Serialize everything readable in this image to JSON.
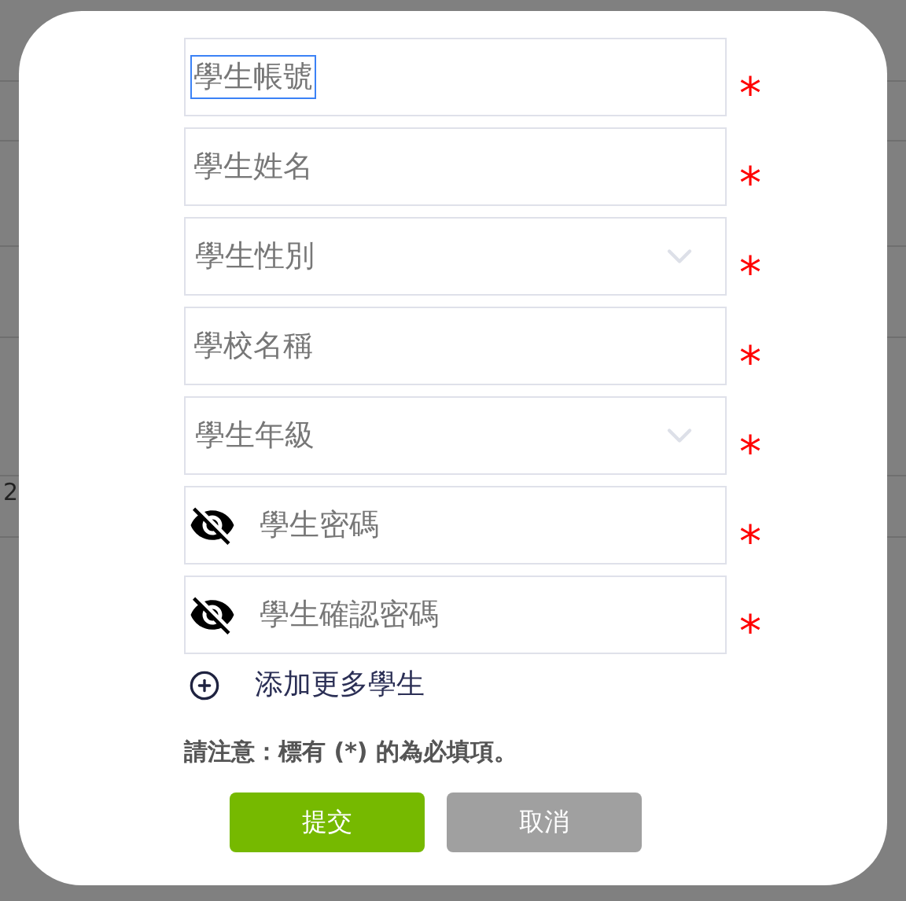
{
  "backdrop": {
    "row_label": "2"
  },
  "form": {
    "required_mark": "*",
    "fields": [
      {
        "kind": "text",
        "placeholder": "學生帳號",
        "required": true,
        "focused": true
      },
      {
        "kind": "text",
        "placeholder": "學生姓名",
        "required": true,
        "focused": false
      },
      {
        "kind": "select",
        "placeholder": "學生性別",
        "required": true,
        "focused": false
      },
      {
        "kind": "text",
        "placeholder": "學校名稱",
        "required": true,
        "focused": false
      },
      {
        "kind": "select",
        "placeholder": "學生年級",
        "required": true,
        "focused": false
      },
      {
        "kind": "password",
        "placeholder": "學生密碼",
        "required": true,
        "focused": false
      },
      {
        "kind": "password",
        "placeholder": "學生確認密碼",
        "required": true,
        "focused": false
      }
    ],
    "add_more": "添加更多學生",
    "note": "請注意：標有 (*) 的為必填項。",
    "buttons": [
      {
        "label": "提交",
        "kind": "primary"
      },
      {
        "label": "取消",
        "kind": "secondary"
      }
    ]
  }
}
